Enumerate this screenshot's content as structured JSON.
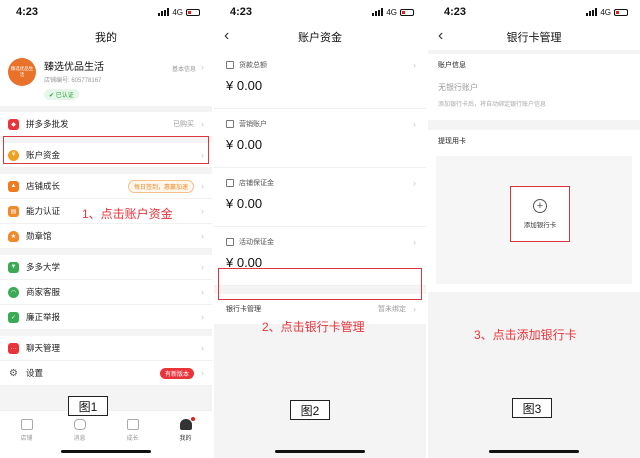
{
  "status": {
    "time": "4:23",
    "network": "4G"
  },
  "panel1": {
    "title": "我的",
    "store": {
      "avatar_text": "臻选优品生活",
      "name": "臻选优品生活",
      "id_line": "店铺编号: 605778167",
      "verified": "已认证",
      "basic": "基本信息"
    },
    "items": [
      {
        "label": "拼多多批发",
        "extra": "已购买",
        "icon": "wholesale-icon",
        "color": "#e9343a"
      },
      {
        "label": "账户资金",
        "extra": "",
        "icon": "yen-icon",
        "color": "#f0a020"
      },
      {
        "label": "店铺成长",
        "extra": "每日签到，惠赢加速",
        "icon": "growth-icon",
        "color": "#f07a20"
      },
      {
        "label": "能力认证",
        "extra": "",
        "icon": "cert-icon",
        "color": "#f08a2a"
      },
      {
        "label": "勋章馆",
        "extra": "",
        "icon": "medal-icon",
        "color": "#f08a2a"
      },
      {
        "label": "多多大学",
        "extra": "",
        "icon": "graduation-icon",
        "color": "#3aaa55"
      },
      {
        "label": "商家客服",
        "extra": "",
        "icon": "headset-icon",
        "color": "#3aaa55"
      },
      {
        "label": "廉正举报",
        "extra": "",
        "icon": "shield-icon",
        "color": "#3aaa55"
      },
      {
        "label": "聊天管理",
        "extra": "",
        "icon": "chat-icon",
        "color": "#e9343a"
      },
      {
        "label": "设置",
        "extra": "有新版本",
        "icon": "gear-icon",
        "color": "#555555"
      }
    ],
    "tabs": [
      "店铺",
      "消息",
      "成长",
      "我的"
    ],
    "annotation": "1、点击账户资金",
    "fig": "图1"
  },
  "panel2": {
    "title": "账户资金",
    "accounts": [
      {
        "label": "货款总额",
        "amount": "¥ 0.00"
      },
      {
        "label": "营销账户",
        "amount": "¥ 0.00"
      },
      {
        "label": "店铺保证金",
        "amount": "¥ 0.00"
      },
      {
        "label": "活动保证金",
        "amount": "¥ 0.00"
      }
    ],
    "bank_row": {
      "label": "银行卡管理",
      "status": "暂未绑定"
    },
    "annotation": "2、点击银行卡管理",
    "fig": "图2"
  },
  "panel3": {
    "title": "银行卡管理",
    "section1": "账户信息",
    "no_account": "无银行账户",
    "hint": "添加银行卡后，将自动绑定银行账户信息",
    "section2": "提现用卡",
    "add_card": "添加银行卡",
    "annotation": "3、点击添加银行卡",
    "fig": "图3"
  },
  "colors": {
    "accent_red": "#e8333a"
  }
}
